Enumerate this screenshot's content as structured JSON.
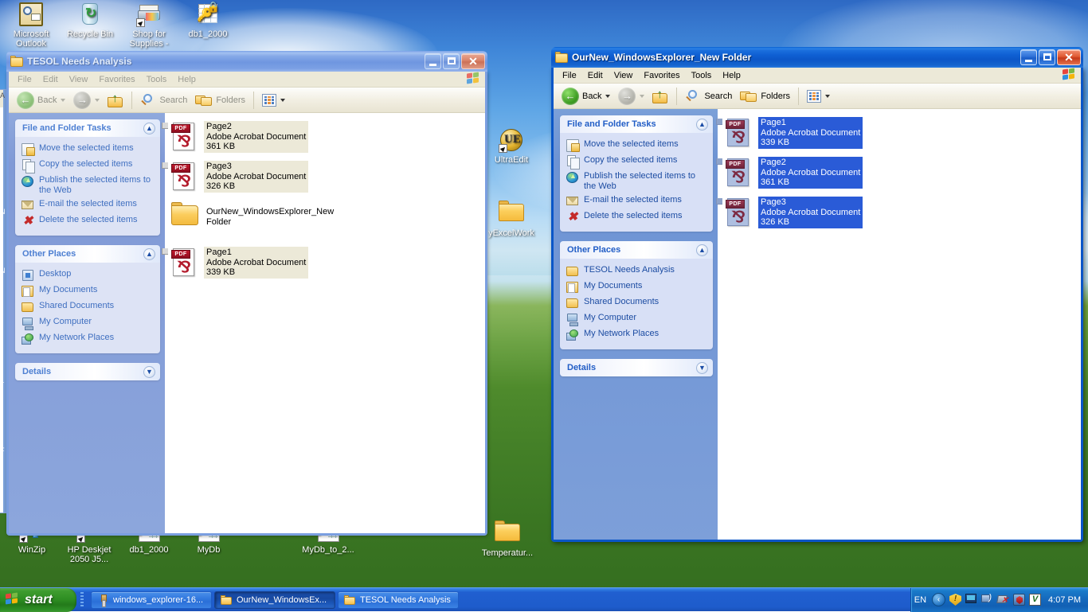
{
  "desktop": {
    "icons_top": [
      {
        "label": "Microsoft Outlook",
        "icon": "outlook-icon"
      },
      {
        "label": "Recycle Bin",
        "icon": "recycle-bin-icon"
      },
      {
        "label": "Shop for Supplies -",
        "icon": "printer-shortcut-icon"
      },
      {
        "label": "db1_2000",
        "icon": "access-database-icon"
      }
    ],
    "icons_mid": [
      {
        "label": "UltraEdit",
        "icon": "ultraedit-icon"
      },
      {
        "label": "yExcelWork",
        "icon": "folder-icon"
      }
    ],
    "icons_bottom": [
      {
        "label": "WinZip",
        "icon": "winzip-icon"
      },
      {
        "label": "HP Deskjet 2050 J5...",
        "icon": "printer-shortcut-icon"
      },
      {
        "label": "db1_2000",
        "icon": "access-database-icon"
      },
      {
        "label": "MyDb",
        "icon": "access-database-icon"
      },
      {
        "label": "MyDb_to_2...",
        "icon": "access-database-icon"
      },
      {
        "label": "Temperatur...",
        "icon": "folder-icon"
      }
    ]
  },
  "window1": {
    "title": "TESOL Needs Analysis",
    "active": false,
    "menu": [
      "File",
      "Edit",
      "View",
      "Favorites",
      "Tools",
      "Help"
    ],
    "toolbar": {
      "back": "Back",
      "search": "Search",
      "folders": "Folders"
    },
    "tasks_panel": {
      "title": "File and Folder Tasks",
      "items": [
        {
          "label": "Move the selected items",
          "icon": "move-icon"
        },
        {
          "label": "Copy the selected items",
          "icon": "copy-icon"
        },
        {
          "label": "Publish the selected items to the Web",
          "icon": "publish-web-icon"
        },
        {
          "label": "E-mail the selected items",
          "icon": "email-icon"
        },
        {
          "label": "Delete the selected items",
          "icon": "delete-icon"
        }
      ]
    },
    "places_panel": {
      "title": "Other Places",
      "items": [
        {
          "label": "Desktop",
          "icon": "desktop-icon"
        },
        {
          "label": "My Documents",
          "icon": "my-documents-icon"
        },
        {
          "label": "Shared Documents",
          "icon": "shared-documents-icon"
        },
        {
          "label": "My Computer",
          "icon": "my-computer-icon"
        },
        {
          "label": "My Network Places",
          "icon": "my-network-places-icon"
        }
      ]
    },
    "details_panel": {
      "title": "Details"
    },
    "files": [
      {
        "name": "Page2",
        "type": "Adobe Acrobat Document",
        "size": "361 KB",
        "kind": "pdf",
        "selected": true
      },
      {
        "name": "Page3",
        "type": "Adobe Acrobat Document",
        "size": "326 KB",
        "kind": "pdf",
        "selected": true
      },
      {
        "name": "OurNew_WindowsExplorer_New",
        "type": "Folder",
        "size": "",
        "kind": "folder",
        "selected": false
      },
      {
        "name": "Page1",
        "type": "Adobe Acrobat Document",
        "size": "339 KB",
        "kind": "pdf",
        "selected": true
      }
    ]
  },
  "window2": {
    "title": "OurNew_WindowsExplorer_New Folder",
    "active": true,
    "menu": [
      "File",
      "Edit",
      "View",
      "Favorites",
      "Tools",
      "Help"
    ],
    "toolbar": {
      "back": "Back",
      "search": "Search",
      "folders": "Folders"
    },
    "tasks_panel": {
      "title": "File and Folder Tasks",
      "items": [
        {
          "label": "Move the selected items",
          "icon": "move-icon"
        },
        {
          "label": "Copy the selected items",
          "icon": "copy-icon"
        },
        {
          "label": "Publish the selected items to the Web",
          "icon": "publish-web-icon"
        },
        {
          "label": "E-mail the selected items",
          "icon": "email-icon"
        },
        {
          "label": "Delete the selected items",
          "icon": "delete-icon"
        }
      ]
    },
    "places_panel": {
      "title": "Other Places",
      "items": [
        {
          "label": "TESOL Needs Analysis",
          "icon": "folder-icon"
        },
        {
          "label": "My Documents",
          "icon": "my-documents-icon"
        },
        {
          "label": "Shared Documents",
          "icon": "shared-documents-icon"
        },
        {
          "label": "My Computer",
          "icon": "my-computer-icon"
        },
        {
          "label": "My Network Places",
          "icon": "my-network-places-icon"
        }
      ]
    },
    "details_panel": {
      "title": "Details"
    },
    "files": [
      {
        "name": "Page1",
        "type": "Adobe Acrobat Document",
        "size": "339 KB",
        "kind": "pdf",
        "selected": true
      },
      {
        "name": "Page2",
        "type": "Adobe Acrobat Document",
        "size": "361 KB",
        "kind": "pdf",
        "selected": true
      },
      {
        "name": "Page3",
        "type": "Adobe Acrobat Document",
        "size": "326 KB",
        "kind": "pdf",
        "selected": true
      }
    ]
  },
  "taskbar": {
    "start_label": "start",
    "buttons": [
      {
        "label": "windows_explorer-16...",
        "icon": "paint-icon",
        "active": false
      },
      {
        "label": "OurNew_WindowsEx...",
        "icon": "folder-icon",
        "active": true
      },
      {
        "label": "TESOL Needs Analysis",
        "icon": "folder-icon",
        "active": false
      }
    ],
    "tray": {
      "language": "EN",
      "show_hidden_label": "‹",
      "icons": [
        "security-alert-icon",
        "display-icon",
        "network-icon",
        "network-disconnected-icon",
        "antivirus-icon",
        "vmware-icon"
      ],
      "clock": "4:07 PM"
    }
  },
  "colors": {
    "accent": "#0a56c8",
    "title_active": "#0c57c8",
    "title_inactive": "#7ba3e8",
    "selection_active": "#2a5bd7",
    "selection_inactive": "#ece9d8",
    "taskpane": "#7ba0d8",
    "taskbar": "#205fd0",
    "start_green": "#2f8f23",
    "pdf_red": "#b31b2c",
    "link_blue": "#1c4ca2"
  }
}
